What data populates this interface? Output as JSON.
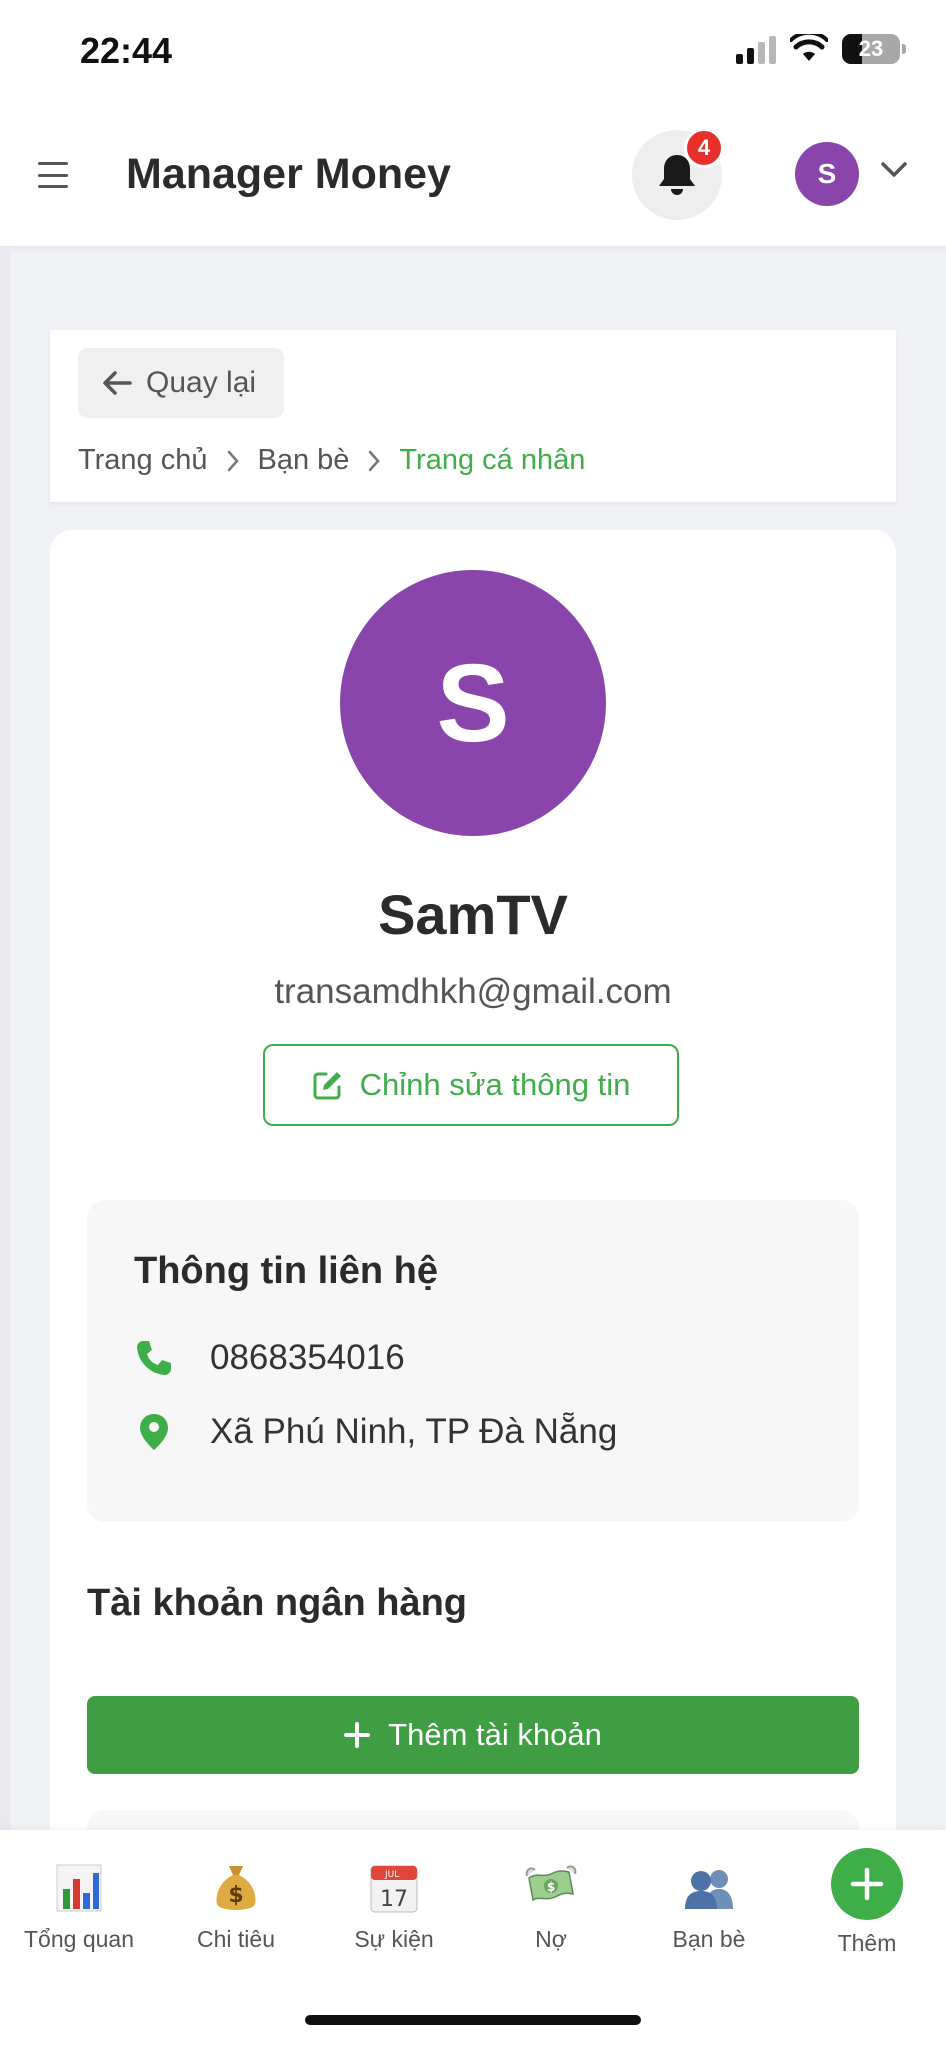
{
  "status_bar": {
    "time": "22:44",
    "battery": "23"
  },
  "header": {
    "title": "Manager Money",
    "notification_count": "4",
    "avatar_initial": "S"
  },
  "breadcrumb_card": {
    "back_label": "Quay lại",
    "items": [
      "Trang chủ",
      "Bạn bè",
      "Trang cá nhân"
    ]
  },
  "profile": {
    "avatar_initial": "S",
    "name": "SamTV",
    "email": "transamdhkh@gmail.com",
    "edit_label": "Chỉnh sửa thông tin",
    "contact": {
      "title": "Thông tin liên hệ",
      "phone": "0868354016",
      "address": "Xã Phú Ninh, TP Đà Nẵng"
    },
    "bank": {
      "title": "Tài khoản ngân hàng",
      "add_label": "Thêm tài khoản"
    }
  },
  "bottom_nav": {
    "items": [
      {
        "label": "Tổng quan",
        "icon": "bar-chart-icon"
      },
      {
        "label": "Chi tiêu",
        "icon": "money-bag-icon"
      },
      {
        "label": "Sự kiện",
        "icon": "calendar-icon"
      },
      {
        "label": "Nợ",
        "icon": "flying-money-icon"
      },
      {
        "label": "Bạn bè",
        "icon": "people-icon"
      },
      {
        "label": "Thêm",
        "icon": "plus-icon"
      }
    ],
    "calendar_month": "JUL",
    "calendar_day": "17"
  },
  "colors": {
    "accent_green": "#3fae49",
    "avatar_purple": "#8a45ad",
    "badge_red": "#e6302a"
  }
}
